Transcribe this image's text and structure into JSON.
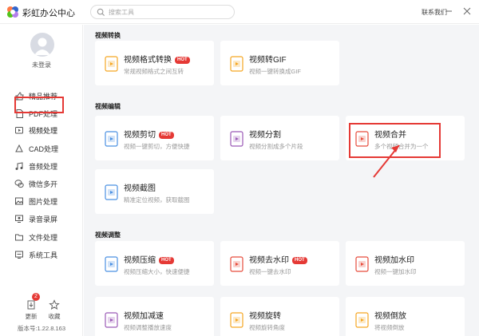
{
  "app": {
    "title": "彩虹办公中心"
  },
  "search": {
    "placeholder": "搜索工具"
  },
  "header": {
    "contact": "联系我们"
  },
  "user": {
    "status": "未登录"
  },
  "sidebar": {
    "items": [
      {
        "label": "精品推荐",
        "icon": "thumbs-up-icon"
      },
      {
        "label": "PDF处理",
        "icon": "document-icon"
      },
      {
        "label": "视频处理",
        "icon": "video-icon"
      },
      {
        "label": "CAD处理",
        "icon": "cad-icon"
      },
      {
        "label": "音频处理",
        "icon": "music-icon"
      },
      {
        "label": "微信多开",
        "icon": "wechat-icon"
      },
      {
        "label": "图片处理",
        "icon": "image-icon"
      },
      {
        "label": "录音录屏",
        "icon": "screen-record-icon"
      },
      {
        "label": "文件处理",
        "icon": "folder-icon"
      },
      {
        "label": "系统工具",
        "icon": "system-tools-icon"
      }
    ],
    "active": "视频处理"
  },
  "bottom": {
    "update_label": "更新",
    "update_badge": "2",
    "favorite_label": "收藏",
    "version": "版本号:1.22.8.163"
  },
  "sections": [
    {
      "title": "视频转换",
      "cards": [
        {
          "name": "视频格式转换",
          "desc": "常规视频格式之间互转",
          "hot": true,
          "color": "#f5a623"
        },
        {
          "name": "视频转GIF",
          "desc": "视频一键转换成GIF",
          "hot": false,
          "color": "#f5a623"
        }
      ]
    },
    {
      "title": "视频编辑",
      "cards": [
        {
          "name": "视频剪切",
          "desc": "视频一键剪切，方便快捷",
          "hot": true,
          "color": "#4a90e2"
        },
        {
          "name": "视频分割",
          "desc": "视频分割成多个片段",
          "hot": false,
          "color": "#9b59b6"
        },
        {
          "name": "视频合并",
          "desc": "多个视频合并为一个",
          "hot": false,
          "color": "#e74c3c"
        },
        {
          "name": "视频截图",
          "desc": "精准定位视频，获取截图",
          "hot": false,
          "color": "#4a90e2"
        }
      ]
    },
    {
      "title": "视频调整",
      "cards": [
        {
          "name": "视频压缩",
          "desc": "视频压缩大小，快速便捷",
          "hot": true,
          "color": "#4a90e2"
        },
        {
          "name": "视频去水印",
          "desc": "视频一键去水印",
          "hot": true,
          "color": "#e74c3c"
        },
        {
          "name": "视频加水印",
          "desc": "视频一键加水印",
          "hot": false,
          "color": "#e74c3c"
        },
        {
          "name": "视频加减速",
          "desc": "视频调整播放速度",
          "hot": false,
          "color": "#9b59b6"
        },
        {
          "name": "视频旋转",
          "desc": "视频旋转角度",
          "hot": false,
          "color": "#f5a623"
        },
        {
          "name": "视频倒放",
          "desc": "将视频倒放",
          "hot": false,
          "color": "#f5a623"
        }
      ]
    }
  ],
  "hot_label": "HOT",
  "colors": {
    "accent": "#5b6ef5",
    "highlight": "#e53935"
  }
}
